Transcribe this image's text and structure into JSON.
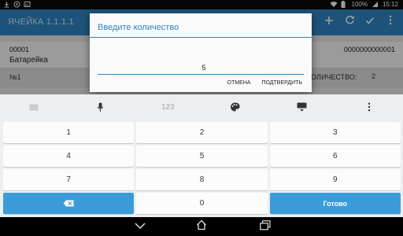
{
  "status": {
    "battery": "100%",
    "time": "15:12"
  },
  "appbar": {
    "title": "ЯЧЕЙКА 1.1.1.1"
  },
  "item": {
    "code": "00001",
    "name": "Батарейка",
    "barcode": "0000000000001",
    "number": "№1",
    "qty_label": "КОЛИЧЕСТВО:",
    "qty_value": "2"
  },
  "dialog": {
    "title": "Введите количество",
    "value": "5",
    "cancel": "ОТМЕНА",
    "confirm": "ПОДТВЕРДИТЬ"
  },
  "keyboard": {
    "toolbar": {
      "numbers_label": "123"
    },
    "rows": [
      [
        "1",
        "2",
        "3"
      ],
      [
        "4",
        "5",
        "6"
      ],
      [
        "7",
        "8",
        "9"
      ]
    ],
    "zero": "0",
    "done": "Готово"
  },
  "colors": {
    "accent": "#2f86c6",
    "key_blue": "#3a9bd8"
  }
}
